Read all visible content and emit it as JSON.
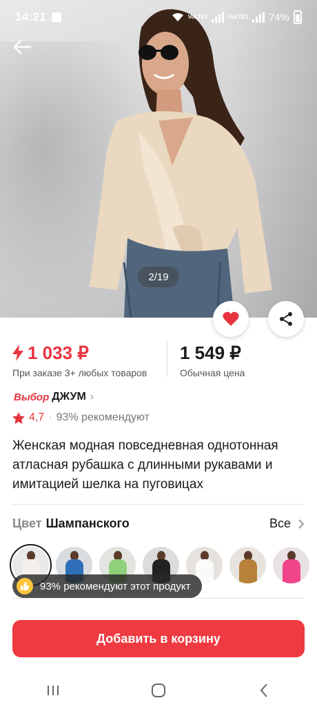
{
  "status_bar": {
    "time": "14:21",
    "battery": "74%",
    "sim1": "VoLTE1",
    "sim2": "VoLTE2"
  },
  "gallery": {
    "counter": "2/19"
  },
  "price": {
    "promo_value": "1 033 ₽",
    "promo_note": "При заказе 3+ любых товаров",
    "regular_value": "1 549 ₽",
    "regular_note": "Обычная цена"
  },
  "seller": {
    "badge": "Выбор",
    "name": "ДЖУМ"
  },
  "rating": {
    "score": "4,7",
    "recommend": "93% рекомендуют"
  },
  "product": {
    "title": "Женская модная повседневная однотонная атласная рубашка с длинными рукавами и имитацией шелка на пуговицах"
  },
  "color": {
    "label": "Цвет",
    "value": "Шампанского",
    "all_label": "Все",
    "swatches": [
      {
        "color": "#f3f0ec",
        "bg": "#e9e9e9"
      },
      {
        "color": "#2e6fb8",
        "bg": "#d9dcdf"
      },
      {
        "color": "#8fd17a",
        "bg": "#e2e4e0"
      },
      {
        "color": "#222222",
        "bg": "#dcdcdc"
      },
      {
        "color": "#fafafa",
        "bg": "#e6e1dc"
      },
      {
        "color": "#b8813a",
        "bg": "#e7e3dd"
      },
      {
        "color": "#f0458a",
        "bg": "#e8e2e4"
      }
    ]
  },
  "toast": {
    "text": "93% рекомендуют этот продукт"
  },
  "actions": {
    "add_to_cart": "Добавить в корзину"
  },
  "colors": {
    "accent": "#ef3a42",
    "price_red": "#e7343f"
  }
}
